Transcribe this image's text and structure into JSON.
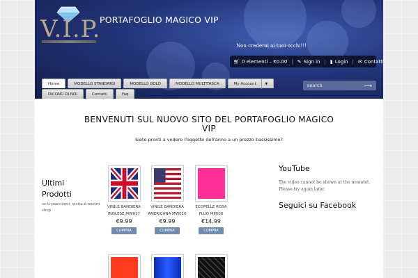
{
  "header": {
    "logo_text": "V.I.P.",
    "site_title": "PORTAFOGLIO MAGICO VIP",
    "tagline": "Non crederai ai tuoi occhi!!!",
    "cart": "0 elementi – €0.00",
    "sign_in": "Sign in",
    "login": "Login",
    "contacts": "Contatti"
  },
  "nav": {
    "row1": [
      {
        "label": "Home",
        "active": true
      },
      {
        "label": "MODELLO STANDARD"
      },
      {
        "label": "MODELLO GOLD"
      },
      {
        "label": "MODELLO MULTITASCA"
      },
      {
        "label": "My Account",
        "dropdown": "▼"
      }
    ],
    "row2": [
      {
        "label": "DICONO DI NOI"
      },
      {
        "label": "Contatti"
      },
      {
        "label": "Faq"
      }
    ]
  },
  "search": {
    "placeholder": "search",
    "arrow": "⟶"
  },
  "main": {
    "welcome": "BENVENUTI SUL NUOVO SITO DEL PORTAFOGLIO MAGICO VIP",
    "subwelcome": "Siete pronti a vedere l'oggetto dell'anno a un prezzo bassissimo?"
  },
  "sidebar_left": {
    "title": "Ultimi Prodotti",
    "note": "se ti piacciono, visita il nostro shop"
  },
  "products": [
    {
      "name": "VINILE BANDIERA INGLESE MW017",
      "price": "€9.99",
      "button": "COMPRA",
      "image": "uk-flag"
    },
    {
      "name": "VINILE BANDIERA AMERICANA MW016",
      "price": "€9.99",
      "button": "COMPRA",
      "image": "us-flag"
    },
    {
      "name": "ECOPELLE ROSA FLUO MP008",
      "price": "€14.99",
      "button": "COMPRA",
      "image": "pink"
    },
    {
      "name": "",
      "price": "",
      "button": "",
      "image": "orange"
    },
    {
      "name": "",
      "price": "",
      "button": "",
      "image": "blue"
    },
    {
      "name": "",
      "price": "",
      "button": "",
      "image": "black-croc"
    }
  ],
  "sidebar_right": {
    "youtube_title": "YouTube",
    "youtube_note": "The video cannot be shown at the moment. Please try again later.",
    "facebook_title": "Seguici su Facebook"
  },
  "colors": {
    "header_dark": "#131c4a",
    "header_light": "#3f5fb0",
    "buy_button": "#6f8baf",
    "pink": "#ff2f9a",
    "orange": "#ff3b1f",
    "blue": "#1540d8"
  }
}
